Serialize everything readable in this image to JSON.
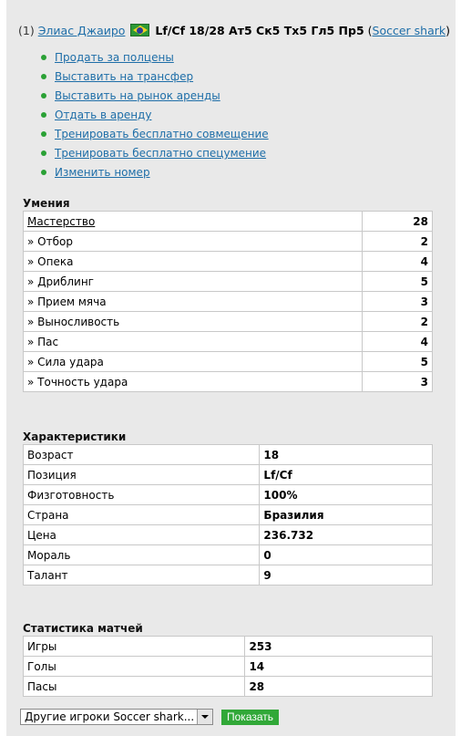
{
  "header": {
    "num": "(1)",
    "player_name": "Элиас Джаиро",
    "summary": "Lf/Cf 18/28 Ат5 Ск5 Тх5 Гл5 Пр5",
    "team_open": "(",
    "team": "Soccer shark",
    "team_close": ")",
    "flag_icon": "brazil-flag-icon"
  },
  "actions": [
    "Продать за полцены",
    "Выставить на трансфер",
    "Выставить на рынок аренды",
    "Отдать в аренду",
    "Тренировать бесплатно совмещение",
    "Тренировать бесплатно спецумение",
    "Изменить номер"
  ],
  "skills": {
    "title": "Умения",
    "rows": [
      {
        "label": "Мастерство",
        "value": "28"
      },
      {
        "label": "» Отбор",
        "value": "2"
      },
      {
        "label": "» Опека",
        "value": "4"
      },
      {
        "label": "» Дриблинг",
        "value": "5"
      },
      {
        "label": "» Прием мяча",
        "value": "3"
      },
      {
        "label": "» Выносливость",
        "value": "2"
      },
      {
        "label": "» Пас",
        "value": "4"
      },
      {
        "label": "» Сила удара",
        "value": "5"
      },
      {
        "label": "» Точность удара",
        "value": "3"
      }
    ]
  },
  "characteristics": {
    "title": "Характеристики",
    "rows": [
      {
        "label": "Возраст",
        "value": "18"
      },
      {
        "label": "Позиция",
        "value": "Lf/Cf"
      },
      {
        "label": "Физготовность",
        "value": "100%"
      },
      {
        "label": "Страна",
        "value": "Бразилия"
      },
      {
        "label": "Цена",
        "value": "236.732"
      },
      {
        "label": "Мораль",
        "value": "0"
      },
      {
        "label": "Талант",
        "value": "9"
      }
    ]
  },
  "match_stats": {
    "title": "Статистика матчей",
    "rows": [
      {
        "label": "Игры",
        "value": "253"
      },
      {
        "label": "Голы",
        "value": "14"
      },
      {
        "label": "Пасы",
        "value": "28"
      }
    ]
  },
  "bottom": {
    "select_value": "Другие игроки Soccer shark...",
    "show_button": "Показать"
  },
  "colors": {
    "link": "#1e6ea8",
    "bullet": "#2aa135",
    "button": "#31a838",
    "panel_bg": "#e9e9e9"
  }
}
